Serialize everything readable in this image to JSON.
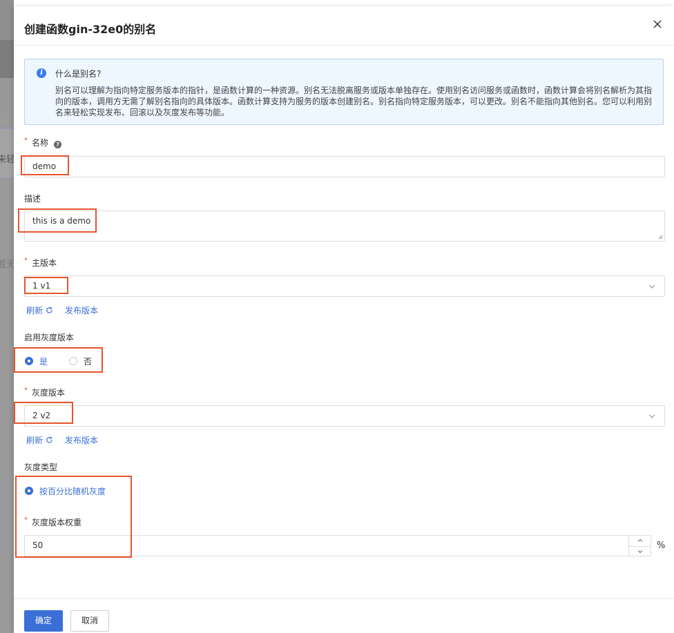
{
  "background": {
    "text_top": "来轻",
    "text_bottom": "暂无"
  },
  "drawer": {
    "title": "创建函数gin-32e0的别名",
    "close_icon": "close-icon"
  },
  "info": {
    "icon": "info-icon",
    "title": "什么是别名?",
    "body": "别名可以理解为指向特定服务版本的指针，是函数计算的一种资源。别名无法脱离服务或版本单独存在。使用别名访问服务或函数时，函数计算会将别名解析为其指向的版本，调用方无需了解别名指向的具体版本。函数计算支持为服务的版本创建别名。别名指向特定服务版本，可以更改。别名不能指向其他别名。您可以利用别名来轻松实现发布、回滚以及灰度发布等功能。"
  },
  "form": {
    "required_mark": "*",
    "name": {
      "label": "名称",
      "value": "demo"
    },
    "description": {
      "label": "描述",
      "value": "this is a demo"
    },
    "main_version": {
      "label": "主版本",
      "value": "1 v1"
    },
    "refresh_label": "刷新",
    "publish_label": "发布版本",
    "enable_gray": {
      "label": "启用灰度版本",
      "options": [
        "是",
        "否"
      ],
      "selected": "是"
    },
    "gray_version": {
      "label": "灰度版本",
      "value": "2 v2"
    },
    "gray_type": {
      "label": "灰度类型",
      "option": "按百分比随机灰度"
    },
    "gray_weight": {
      "label": "灰度版本权重",
      "value": "50",
      "unit": "%"
    }
  },
  "footer": {
    "confirm_label": "确定",
    "cancel_label": "取消"
  },
  "colors": {
    "accent": "#3a6fd8",
    "highlight": "#e4542b",
    "info_bg": "#eef6ff"
  }
}
